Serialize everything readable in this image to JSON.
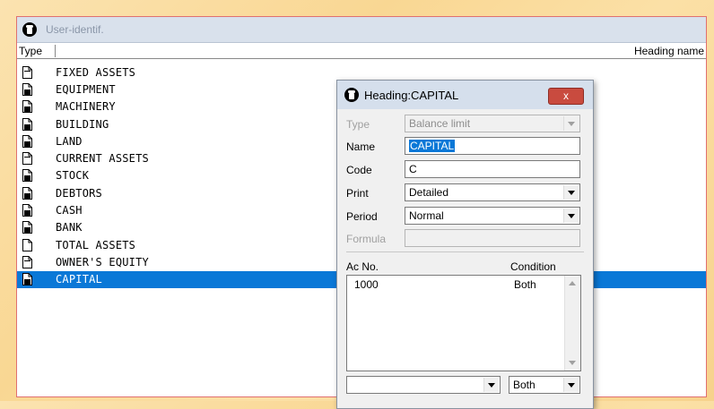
{
  "window": {
    "title": "User-identif."
  },
  "columns": {
    "type": "Type",
    "heading_name": "Heading name"
  },
  "list": [
    {
      "label": "FIXED ASSETS",
      "icon": "document-outline-icon",
      "selected": false
    },
    {
      "label": "EQUIPMENT",
      "icon": "document-filled-icon",
      "selected": false
    },
    {
      "label": "MACHINERY",
      "icon": "document-filled-icon",
      "selected": false
    },
    {
      "label": "BUILDING",
      "icon": "document-filled-icon",
      "selected": false
    },
    {
      "label": "LAND",
      "icon": "document-filled-icon",
      "selected": false
    },
    {
      "label": "CURRENT ASSETS",
      "icon": "document-outline-icon",
      "selected": false
    },
    {
      "label": "STOCK",
      "icon": "document-filled-icon",
      "selected": false
    },
    {
      "label": "DEBTORS",
      "icon": "document-filled-icon",
      "selected": false
    },
    {
      "label": "CASH",
      "icon": "document-filled-icon",
      "selected": false
    },
    {
      "label": "BANK",
      "icon": "document-filled-icon",
      "selected": false
    },
    {
      "label": "TOTAL ASSETS",
      "icon": "document-blank-icon",
      "selected": false
    },
    {
      "label": "OWNER'S EQUITY",
      "icon": "document-outline-icon",
      "selected": false
    },
    {
      "label": "CAPITAL",
      "icon": "document-filled-icon",
      "selected": true
    }
  ],
  "dialog": {
    "title": "Heading:CAPITAL",
    "close": "x",
    "type_label": "Type",
    "type_value": "Balance limit",
    "name_label": "Name",
    "name_value": "CAPITAL",
    "code_label": "Code",
    "code_value": "C",
    "print_label": "Print",
    "print_value": "Detailed",
    "period_label": "Period",
    "period_value": "Normal",
    "formula_label": "Formula",
    "formula_value": "",
    "acno_header": "Ac No.",
    "condition_header": "Condition",
    "rows": [
      {
        "acno": "1000",
        "condition": "Both"
      }
    ],
    "bottom_account_value": "",
    "bottom_condition_value": "Both"
  },
  "colors": {
    "selection": "#0a78d7",
    "close_button": "#c94b3f",
    "title_bar": "#d9e1ec"
  }
}
